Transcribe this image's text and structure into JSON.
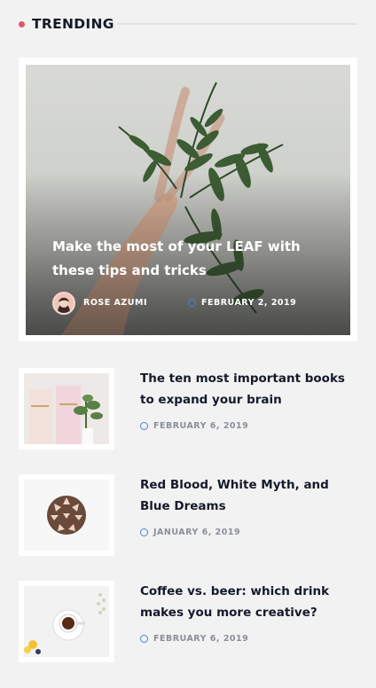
{
  "section": {
    "title": "TRENDING"
  },
  "featured": {
    "title": "Make the most of your LEAF with these tips and tricks",
    "author": "ROSE AZUMI",
    "date": "FEBRUARY 2, 2019"
  },
  "posts": [
    {
      "title": "The ten most important books to expand your brain",
      "date": "FEBRUARY 6, 2019"
    },
    {
      "title": "Red Blood, White Myth, and Blue Dreams",
      "date": "JANUARY 6, 2019"
    },
    {
      "title": "Coffee vs. beer: which drink makes you more creative?",
      "date": "FEBRUARY 6, 2019"
    }
  ],
  "colors": {
    "accent_dot": "#e0566b",
    "clock_icon": "#4a7fe0",
    "background": "#f2f2f2"
  },
  "icons": {
    "date": "clock-icon",
    "section": "dot-icon"
  }
}
